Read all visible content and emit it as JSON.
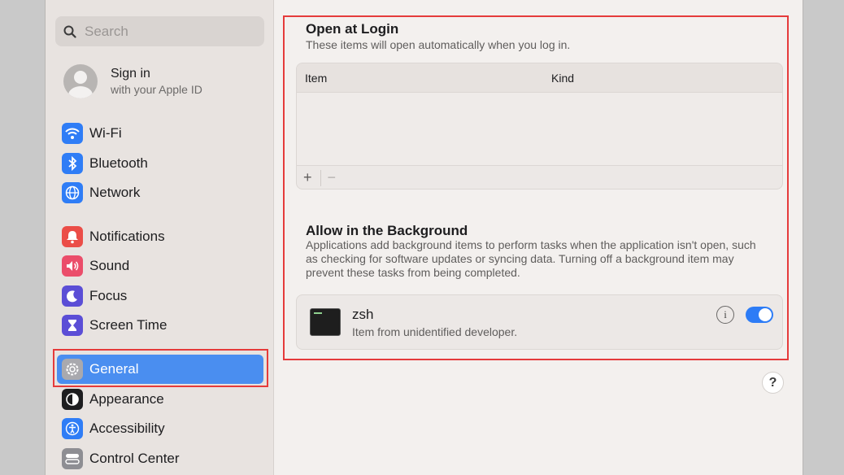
{
  "sidebar": {
    "search_placeholder": "Search",
    "account": {
      "title": "Sign in",
      "subtitle": "with your Apple ID"
    },
    "items": [
      {
        "label": "Wi-Fi",
        "icon": "wifi-icon",
        "color": "#2f7df6"
      },
      {
        "label": "Bluetooth",
        "icon": "bluetooth-icon",
        "color": "#2f7df6"
      },
      {
        "label": "Network",
        "icon": "globe-icon",
        "color": "#2f7df6"
      },
      {
        "label": "Notifications",
        "icon": "bell-icon",
        "color": "#eb4d47"
      },
      {
        "label": "Sound",
        "icon": "speaker-icon",
        "color": "#eb4d6a"
      },
      {
        "label": "Focus",
        "icon": "moon-icon",
        "color": "#5b4ed6"
      },
      {
        "label": "Screen Time",
        "icon": "hourglass-icon",
        "color": "#5b4ed6"
      },
      {
        "label": "General",
        "icon": "gear-icon",
        "color": "#8e8e93",
        "selected": true
      },
      {
        "label": "Appearance",
        "icon": "appearance-icon",
        "color": "#1d1d1f"
      },
      {
        "label": "Accessibility",
        "icon": "accessibility-icon",
        "color": "#2f7df6"
      },
      {
        "label": "Control Center",
        "icon": "control-center-icon",
        "color": "#8e8e93"
      }
    ]
  },
  "main": {
    "login_title": "Open at Login",
    "login_subtitle": "These items will open automatically when you log in.",
    "table": {
      "columns": [
        "Item",
        "Kind"
      ],
      "add_label": "+",
      "remove_label": "−"
    },
    "background_title": "Allow in the Background",
    "background_desc": "Applications add background items to perform tasks when the application isn't open, such as checking for software updates or syncing data. Turning off a background item may prevent these tasks from being completed.",
    "background_item": {
      "name": "zsh",
      "subtitle": "Item from unidentified developer.",
      "info_label": "i",
      "enabled": true
    },
    "help_label": "?"
  },
  "colors": {
    "accent": "#4a8ef0",
    "highlight": "#e53b3b"
  }
}
